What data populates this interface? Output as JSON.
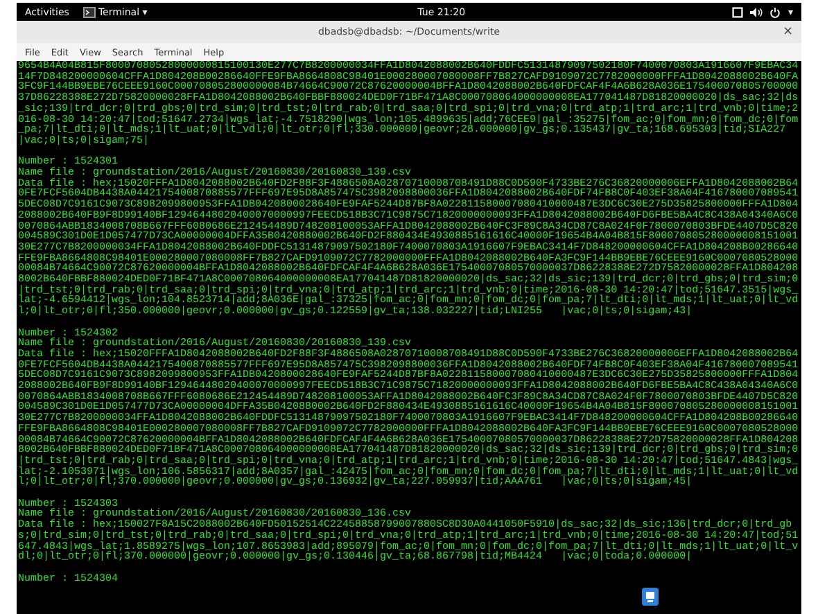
{
  "top_bar": {
    "activities": "Activities",
    "app_menu": "Terminal ▾",
    "clock": "Tue 21:20",
    "system_menu_caret": "▾"
  },
  "window": {
    "title": "dbadsb@dbadsb: ~/Documents/write",
    "close": "×"
  },
  "menu": [
    "File",
    "Edit",
    "View",
    "Search",
    "Terminal",
    "Help"
  ],
  "terminal": {
    "continuation": "9654B4A04B815F80007080528000000815100130E277C7B8200000034FFA1D8042088002B640FDDFC51314879097502180F7400070803A1916607F9EBAC3414F7D848200000604CFFA1D804208B00286640FFE9FBA8664808C98401E000280007080008FF7B827CAFD9109072C7782000000FFFA1D8042088002B640FA3FC9F144BB9EBE76CEEE9160C000708052800000084B74664C90072C87620000004BFFA1D8042088002B640FDFCAF4F4A6B628A036E17540007080570000037D86228388E272D75820000028FFA1D8042088002B640FBBF880024DED0F71BF471A8C000708064000000008EA177041487D81820000020|ds_sac;32|ds_sic;139|trd_dcr;0|trd_gbs;0|trd_sim;0|trd_tst;0|trd_rab;0|trd_saa;0|trd_spi;0|trd_vna;0|trd_atp;1|trd_arc;1|trd_vnb;0|time;2016-08-30 14:20:47|tod;51647.2734|wgs_lat;-4.7518290|wgs_lon;105.4899635|add;76CEE9|gal_:35275|fom_ac;0|fom_mn;0|fom_dc;0|fom_pa;7|lt_dti;0|lt_mds;1|lt_uat;0|lt_vdl;0|lt_otr;0|fl;330.000000|geovr;28.000000|gv_gs;0.135437|gv_ta;168.695303|tid;SIA227   |vac;0|ts;0|sigam;75|",
    "records": [
      {
        "number": "Number : 1524301",
        "name_file": "Name file : groundstation/2016/August/20160830/20160830_139.csv",
        "data_file": "Data file : hex;15020FFFA1D8042088002B640FD2F88F3F4886508A02870710008708491D88C0D590F4733BE276C36820000006EFFA1D8042088002B640FE7FCF5604DB4438A0442175400870885577FFF697E95D8A857475C3982098800036FFA1D8042088002B640FDF74FB8C0F403EF38A04F4167800070895415DEC08D7C9161C9073C8982099800953FFA1DB0420800028640FE9FAF5244D87BF8A022811580007080410000487E3DC6C30E275D35825800000FFFA1D8042088002B640FB9F8D99140BF12946448020400070000997FEECD518B3C71C9875C71820000000093FFA1D8042088002B640FD6FBE5BA4C8C438A04340A6C00070864ABB1834008708B667FFF6080686E212454489D748208100053AFFA1D8042088002B640FC3F89C8A34CD87C8A024F0F7800070803BFDE4407D5C820004589C301D0E1D057477D73CA00000004DFFA35B0420880002B640FD2F880434E4930885161616C40000F19654B4A04B815F80007080528000000815100130E277C7B8200000034FFA1D8042088002B640FDDFC51314879097502180F7400070803A1916607F9EBAC3414F7D848200000604CFFA1D804208B00286640FFE9FBA8664808C98401E000280007080008FF7B827CAFD9109072C7782000000FFFA1D8042088002B640FA3FC9F144BB9EBE76CEEE9160C000708052800000084B74664C90072C87620000004BFFA1D8042088002B640FDFCAF4F4A6B628A036E17540007080570000037D86228388E272D75820000028FFA1D8042088002B640FBBF880024DED0F71BF471A8C000708064000000008EA177041487D81820000020|ds_sac;32|ds_sic;139|trd_dcr;0|trd_gbs;0|trd_sim;0|trd_tst;0|trd_rab;0|trd_saa;0|trd_spi;0|trd_vna;0|trd_atp;1|trd_arc;1|trd_vnb;0|time;2016-08-30 14:20:47|tod;51647.3515|wgs_lat;-4.6594412|wgs_lon;104.8523714|add;8A036E|gal_:37325|fom_ac;0|fom_mn;0|fom_dc;0|fom_pa;7|lt_dti;0|lt_mds;1|lt_uat;0|lt_vdl;0|lt_otr;0|fl;350.000000|geovr;0.000000|gv_gs;0.122559|gv_ta;138.032227|tid;LNI255   |vac;0|ts;0|sigam;43|"
      },
      {
        "number": "Number : 1524302",
        "name_file": "Name file : groundstation/2016/August/20160830/20160830_139.csv",
        "data_file": "Data file : hex;15020FFFA1D8042088002B640FD2F88F3F4886508A02870710008708491D88C0D590F4733BE276C36820000006EFFA1D8042088002B640FE7FCF5604DB4438A0442175400870885577FFF697E95D8A857475C3982098800036FFA1D8042088002B640FDF74FB8C0F403EF38A04F4167800070895415DEC08D7C9161C9073C8982099800953FFA1DB0420800028640FE9FAF5244D87BF8A022811580007080410000487E3DC6C30E275D35825800000FFFA1D8042088002B640FB9F8D99140BF12946448020400070000997FEECD518B3C71C9875C71820000000093FFA1D8042088002B640FD6FBE5BA4C8C438A04340A6C00070864ABB1834008708B667FFF6080686E212454489D748208100053AFFA1D8042088002B640FC3F89C8A34CD87C8A024F0F7800070803BFDE4407D5C820004589C301D0E1D057477D73CA00000004DFFA35B0420880002B640FD2F880434E4930885161616C40000F19654B4A04B815F80007080528000000815100130E277C7B8200000034FFA1D8042088002B640FDDFC51314879097502180F7400070803A1916607F9EBAC3414F7D848200000604CFFA1D804208B00286640FFE9FBA8664808C98401E000280007080008FF7B827CAFD9109072C7782000000FFFA1D8042088002B640FA3FC9F144BB9EBE76CEEE9160C000708052800000084B74664C90072C87620000004BFFA1D8042088002B640FDFCAF4F4A6B628A036E17540007080570000037D86228388E272D75820000028FFA1D8042088002B640FBBF880024DED0F71BF471A8C000708064000000008EA177041487D81820000020|ds_sac;32|ds_sic;139|trd_dcr;0|trd_gbs;0|trd_sim;0|trd_tst;0|trd_rab;0|trd_saa;0|trd_spi;0|trd_vna;0|trd_atp;1|trd_arc;1|trd_vnb;0|time;2016-08-30 14:20:47|tod;51647.4843|wgs_lat;-2.1053971|wgs_lon;106.5856317|add;8A0357|gal_:42475|fom_ac;0|fom_mn;0|fom_dc;0|fom_pa;7|lt_dti;0|lt_mds;1|lt_uat;0|lt_vdl;0|lt_otr;0|fl;370.000000|geovr;0.000000|gv_gs;0.136932|gv_ta;227.059937|tid;AAA761   |vac;0|ts;0|sigam;45|"
      },
      {
        "number": "Number : 1524303",
        "name_file": "Name file : groundstation/2016/August/20160830/20160830_136.csv",
        "data_file": "Data file : hex;150027F8A15C2088002B640FD50152514C22458858799007880SC8D30A0441050F5910|ds_sac;32|ds_sic;136|trd_dcr;0|trd_gbs;0|trd_sim;0|trd_tst;0|trd_rab;0|trd_saa;0|trd_spi;0|trd_vna;0|trd_atp;1|trd_arc;1|trd_vnb;0|time;2016-08-30 14:20:47|tod;51647.4843|wgs_lat;1.8589275|wgs_lon;107.8653983|add;895079|fom_ac;0|fom_mn;0|fom_dc;0|fom_pa;7|lt_dti;0|lt_mds;1|lt_uat;0|lt_vdl;0|lt_otr;0|fl;370.000000|geovr;0.000000|gv_gs;0.130446|gv_ta;68.867798|tid;MB4424   |vac;0|toda;0.000000|"
      },
      {
        "number": "Number : 1524304"
      }
    ]
  }
}
